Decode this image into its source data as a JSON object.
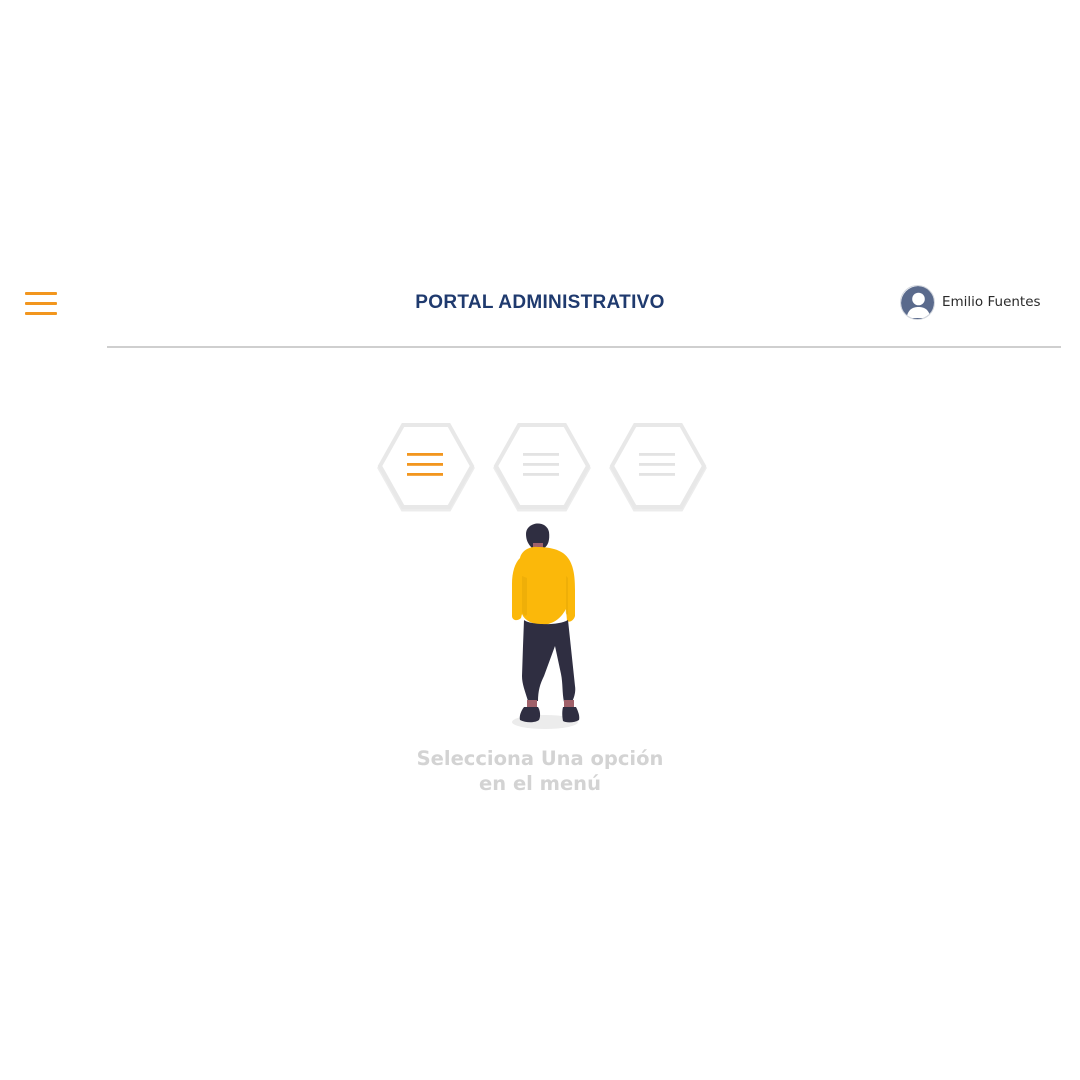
{
  "header": {
    "menu_icon": "hamburger-menu-icon",
    "title": "PORTAL ADMINISTRATIVO",
    "user": {
      "avatar_icon": "user-avatar-icon",
      "name": "Emilio Fuentes"
    }
  },
  "empty_state": {
    "illustration": "person-looking-at-menu-options",
    "option_icons": [
      "menu-lines-icon",
      "menu-lines-icon",
      "menu-lines-icon"
    ],
    "message_line1": "Selecciona Una opción",
    "message_line2": "en el menú"
  },
  "colors": {
    "accent": "#f2961e",
    "title": "#1f3a6e",
    "avatar": "#5a6a8c",
    "divider": "#cfcfcf",
    "message": "#d3d3d3",
    "hex_border": "#e6e6e6",
    "hex_lines_inactive": "#e3e3e3",
    "hoodie": "#fbb80a",
    "pants": "#2f2e41",
    "skin": "#a0616a"
  }
}
